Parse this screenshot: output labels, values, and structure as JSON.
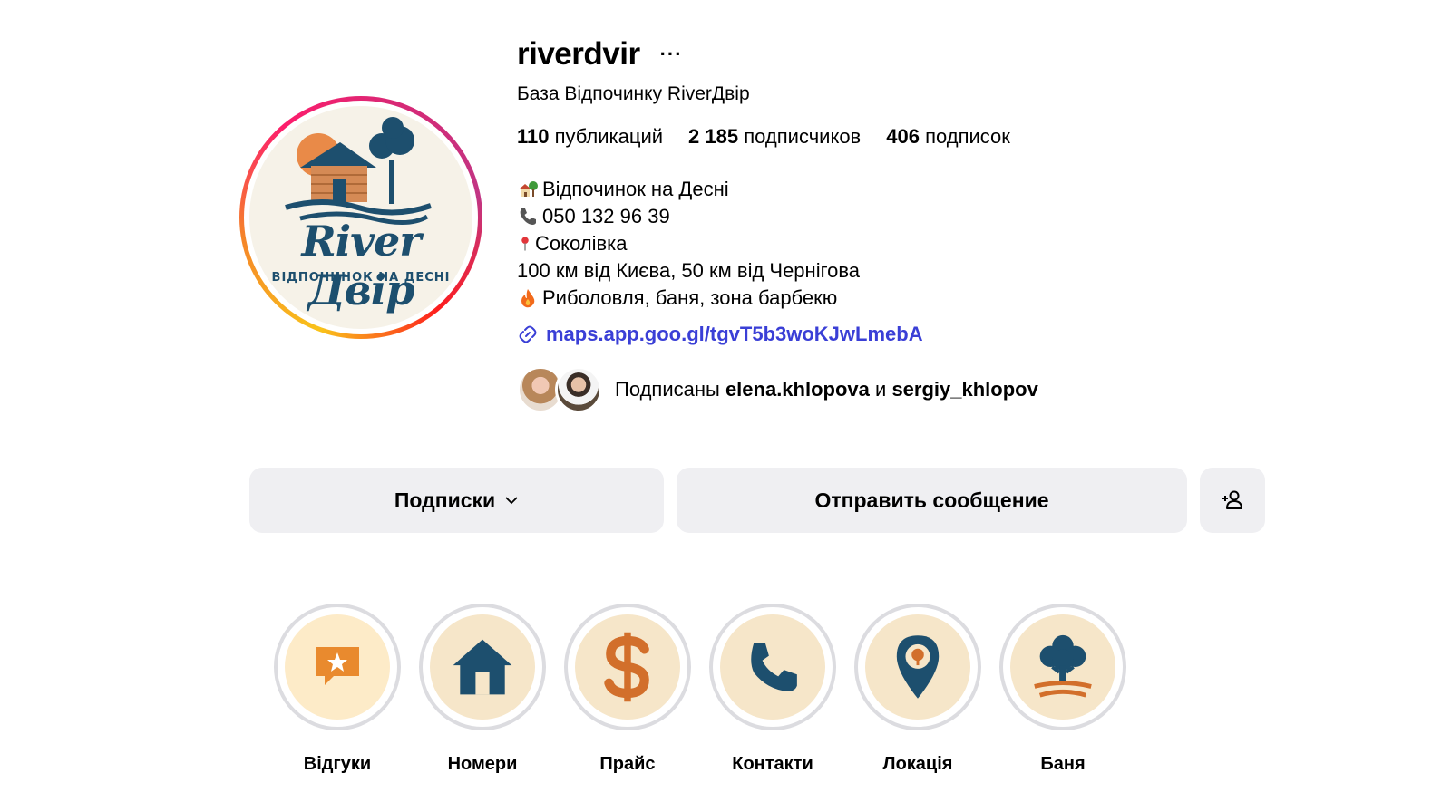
{
  "profile": {
    "username": "riverdvir",
    "full_name": "База Відпочинку RiverДвір",
    "logo": {
      "title": "River Двір",
      "subtitle": "ВІДПОЧИНОК НА ДЕСНІ"
    }
  },
  "stats": [
    {
      "count": "110",
      "label": "публикаций"
    },
    {
      "count": "2 185",
      "label": "подписчиков"
    },
    {
      "count": "406",
      "label": "подписок"
    }
  ],
  "bio": [
    {
      "icon": "house-tree-icon",
      "text": "Відпочинок на Десні"
    },
    {
      "icon": "phone-icon",
      "text": "050 132 96 39"
    },
    {
      "icon": "pin-icon",
      "text": "Соколівка"
    },
    {
      "icon": "",
      "text": "100 км від Києва, 50 км від Чернігова"
    },
    {
      "icon": "fire-icon",
      "text": "Риболовля, баня, зона барбекю"
    }
  ],
  "link": {
    "icon": "link-icon",
    "text": "maps.app.goo.gl/tgvT5b3woKJwLmebA"
  },
  "followed_by": {
    "prefix": "Подписаны",
    "user1": "elena.khlopova",
    "conjunction": "и",
    "user2": "sergiy_khlopov"
  },
  "buttons": {
    "following": "Подписки",
    "message": "Отправить сообщение"
  },
  "highlights": [
    {
      "label": "Відгуки",
      "icon": "review-star-icon"
    },
    {
      "label": "Номери",
      "icon": "house-icon"
    },
    {
      "label": "Прайс",
      "icon": "dollar-icon"
    },
    {
      "label": "Контакти",
      "icon": "phone-icon"
    },
    {
      "label": "Локація",
      "icon": "location-pin-icon"
    },
    {
      "label": "Баня",
      "icon": "tree-icon"
    }
  ],
  "colors": {
    "link": "#3a3fd6",
    "brand_blue": "#1d4f6e",
    "brand_orange": "#e07a2e",
    "button_bg": "#efeff2"
  }
}
